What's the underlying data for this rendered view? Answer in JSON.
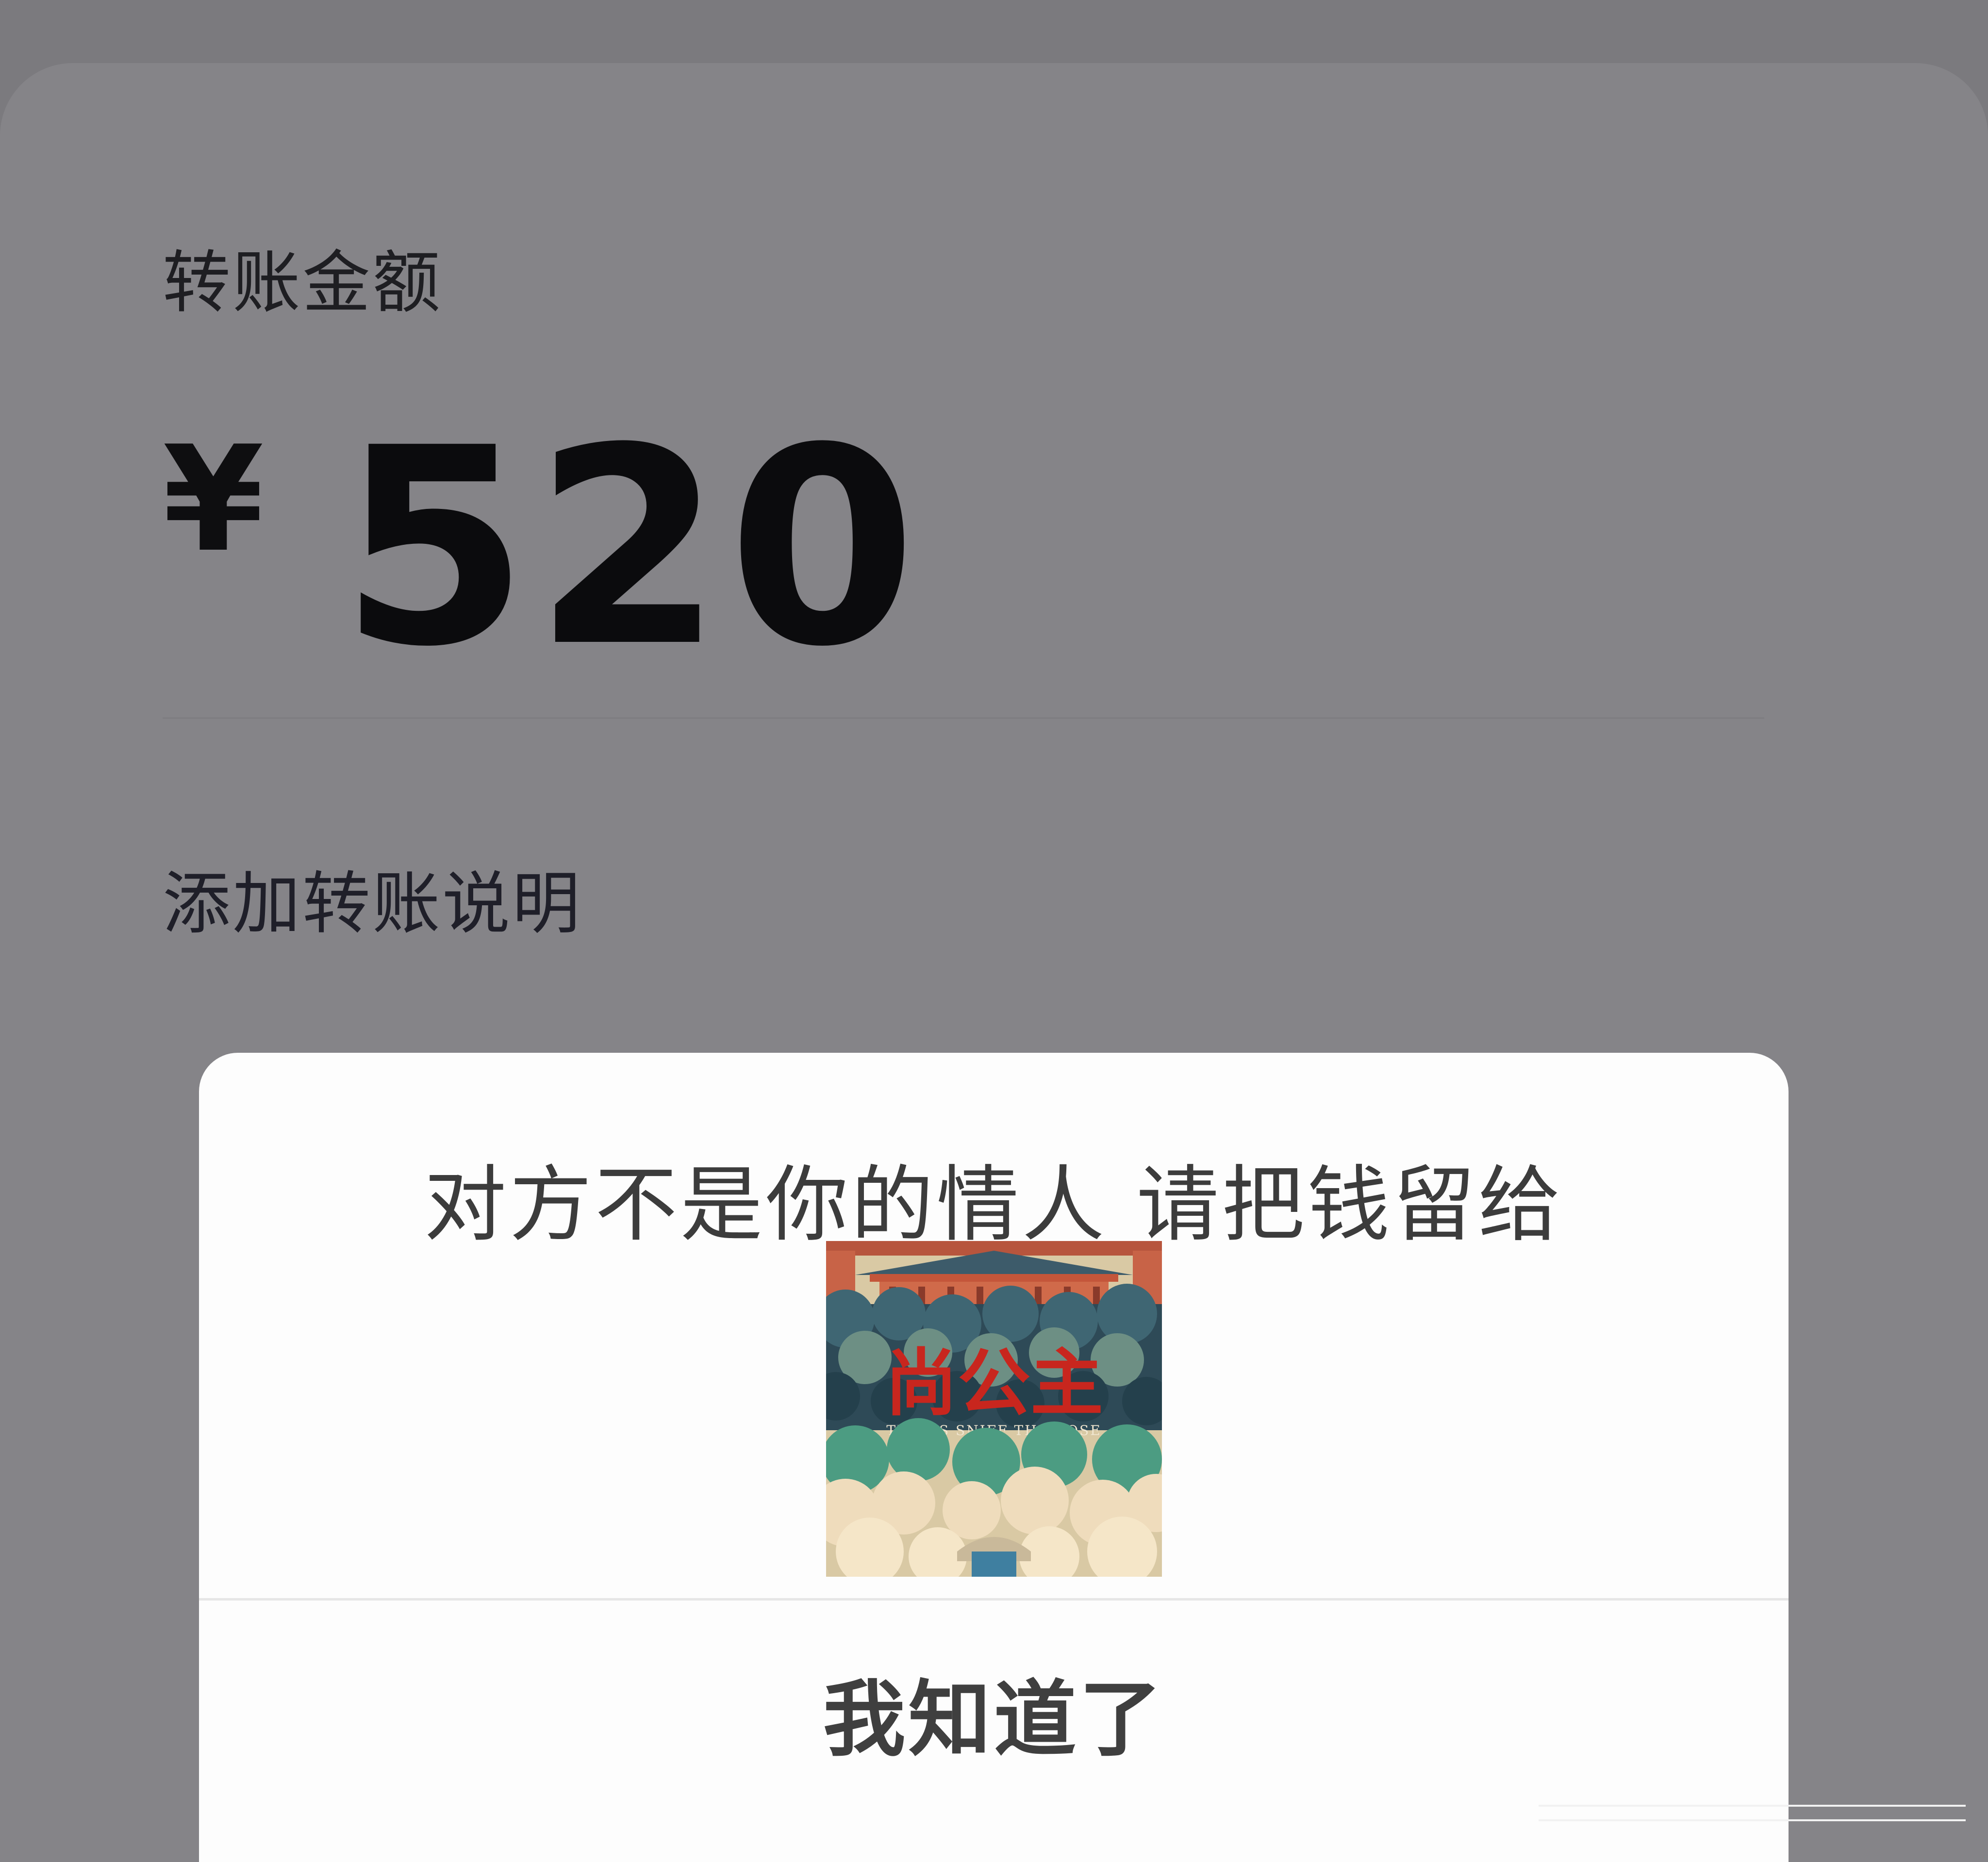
{
  "transfer": {
    "amount_label": "转账金额",
    "currency_symbol": "¥",
    "amount_value": "520",
    "add_note_label": "添加转账说明"
  },
  "dialog": {
    "message": "对方不是你的情人 请把钱留给",
    "image": {
      "title_text": "尚公主",
      "subtitle_text": "TIGERS SNIFF THE ROSE",
      "title_color": "#c8261e"
    },
    "confirm_label": "我知道了"
  },
  "colors": {
    "backdrop": "#7b7a7e",
    "card": "#858488",
    "dialog_bg": "#fdfdfd",
    "dialog_text": "#3c3c3c"
  }
}
